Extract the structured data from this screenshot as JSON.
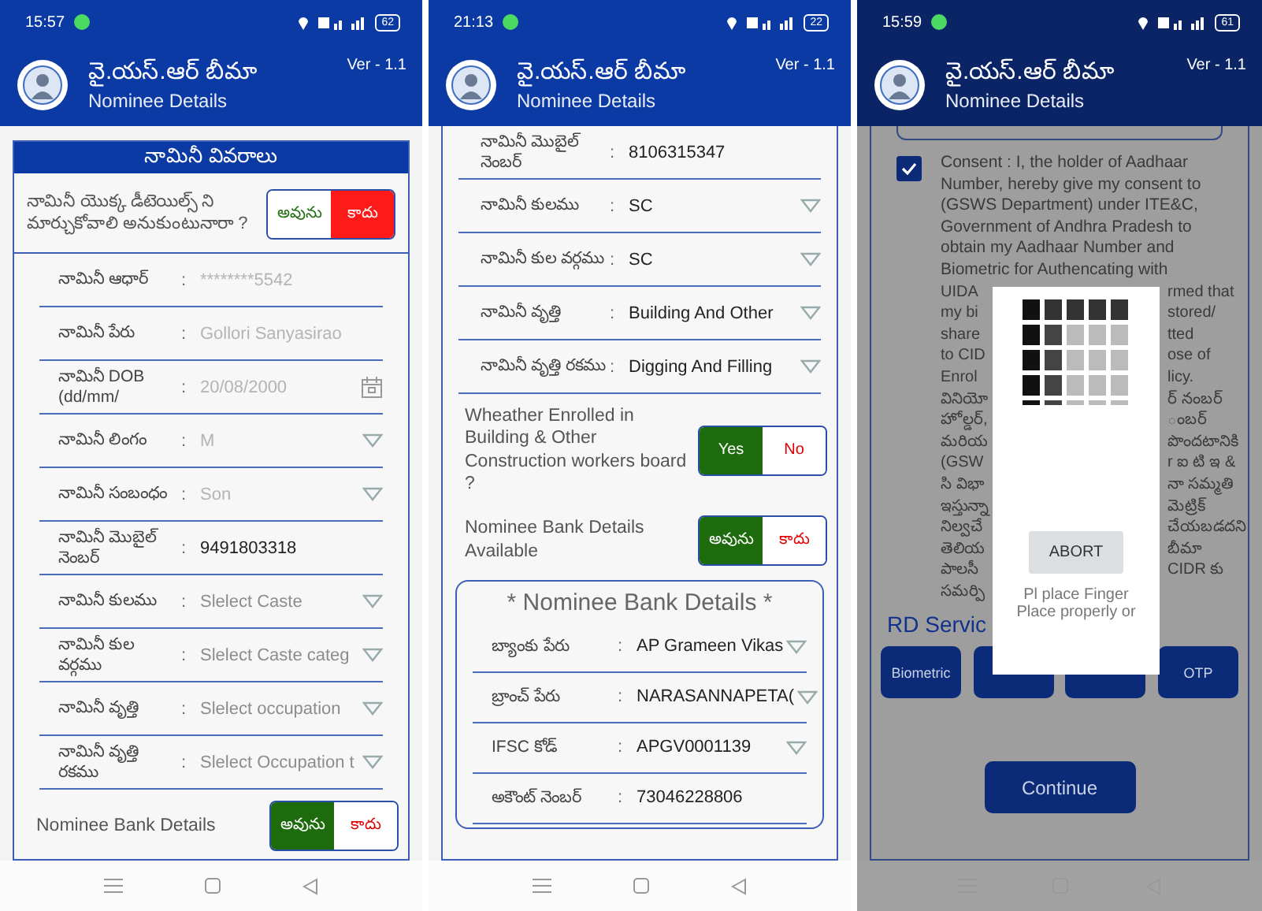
{
  "screens": [
    {
      "status": {
        "time": "15:57",
        "battery": "62"
      },
      "header": {
        "title": "వై.యస్.ఆర్ బీమా",
        "subtitle": "Nominee Details",
        "version": "Ver - 1.1"
      },
      "sections": [
        {
          "kind": "card_title",
          "text": "నామినీ వివరాలు"
        },
        {
          "kind": "toggle",
          "question": "నామినీ యొక్క డీటెయిల్స్ ని మార్చుకోవాలి అనుకుంటునారా ?",
          "options": [
            {
              "label": "అవును",
              "selected": false
            },
            {
              "label": "కాదు",
              "selected": true
            }
          ]
        },
        {
          "kind": "field",
          "label": "నామినీ ఆధార్",
          "colon": ":",
          "value": "********5542",
          "disabled": true
        },
        {
          "kind": "field",
          "label": "నామినీ పేరు",
          "colon": ":",
          "value": "Gollori Sanyasirao",
          "disabled": true
        },
        {
          "kind": "field",
          "label": "నామినీ DOB (dd/mm/",
          "colon": ":",
          "value": "20/08/2000",
          "disabled": true,
          "date_picker": true
        },
        {
          "kind": "field",
          "label": "నామినీ లింగం",
          "colon": ":",
          "value": "M",
          "disabled": true,
          "dropdown": true
        },
        {
          "kind": "field",
          "label": "నామినీ సంబంధం",
          "colon": ":",
          "value": "Son",
          "disabled": true,
          "dropdown": true
        },
        {
          "kind": "field",
          "label": "నామినీ మొబైల్ నెంబర్",
          "colon": ":",
          "value": "9491803318",
          "disabled": false
        },
        {
          "kind": "field",
          "label": "నామినీ కులము",
          "colon": ":",
          "placeholder": "Slelect Caste",
          "disabled": false,
          "dropdown": true
        },
        {
          "kind": "field",
          "label": "నామినీ కుల వర్గము",
          "colon": ":",
          "placeholder": "Slelect Caste categ",
          "disabled": false,
          "dropdown": true
        },
        {
          "kind": "field",
          "label": "నామినీ వృత్తి",
          "colon": ":",
          "placeholder": "Slelect occupation",
          "disabled": false,
          "dropdown": true
        },
        {
          "kind": "field",
          "label": "నామినీ వృత్తి రకము",
          "colon": ":",
          "placeholder": "Slelect Occupation t",
          "disabled": false,
          "dropdown": true
        },
        {
          "kind": "toggle",
          "question": "Nominee Bank Details",
          "options": [
            {
              "label": "అవును",
              "selected": true
            },
            {
              "label": "కాదు",
              "selected": false
            }
          ]
        }
      ]
    },
    {
      "status": {
        "time": "21:13",
        "battery": "22"
      },
      "header": {
        "title": "వై.యస్.ఆర్ బీమా",
        "subtitle": "Nominee Details",
        "version": "Ver - 1.1"
      },
      "sections": [
        {
          "kind": "field",
          "label": "నామినీ మొబైల్ నెంబర్",
          "colon": ":",
          "value": "8106315347",
          "disabled": false
        },
        {
          "kind": "field",
          "label": "నామినీ కులము",
          "colon": ":",
          "value": "SC",
          "disabled": false,
          "dropdown": true
        },
        {
          "kind": "field",
          "label": "నామినీ కుల వర్గము",
          "colon": ":",
          "value": "SC",
          "disabled": false,
          "dropdown": true
        },
        {
          "kind": "field",
          "label": "నామినీ వృత్తి",
          "colon": ":",
          "value": "Building And Other",
          "disabled": false,
          "dropdown": true
        },
        {
          "kind": "field",
          "label": "నామినీ వృత్తి రకము",
          "colon": ":",
          "value": "Digging And Filling",
          "disabled": false,
          "dropdown": true
        },
        {
          "kind": "toggle",
          "question": "Wheather Enrolled in Building & Other Construction workers board ?",
          "options": [
            {
              "label": "Yes",
              "selected": true
            },
            {
              "label": "No",
              "selected": false
            }
          ]
        },
        {
          "kind": "toggle",
          "question": "Nominee Bank Details Available",
          "options": [
            {
              "label": "అవును",
              "selected": true
            },
            {
              "label": "కాదు",
              "selected": false
            }
          ]
        },
        {
          "kind": "bank_card",
          "title": "* Nominee Bank Details *",
          "fields": [
            {
              "label": "బ్యాంకు పేరు",
              "colon": ":",
              "value": "AP Grameen Vikas",
              "disabled": false,
              "dropdown": true
            },
            {
              "label": "బ్రాంచ్ పేరు",
              "colon": ":",
              "value": "NARASANNAPETA(",
              "disabled": false,
              "dropdown": true
            },
            {
              "label": "IFSC కోడ్",
              "colon": ":",
              "value": "APGV0001139",
              "disabled": false,
              "dropdown": true
            },
            {
              "label": "అకౌంట్ నెంబర్",
              "colon": ":",
              "value": "73046228806",
              "disabled": false
            }
          ]
        }
      ]
    },
    {
      "status": {
        "time": "15:59",
        "battery": "61"
      },
      "header": {
        "title": "వై.యస్.ఆర్ బీమా",
        "subtitle": "Nominee Details",
        "version": "Ver - 1.1"
      },
      "sections": [
        {
          "kind": "card_bottom"
        },
        {
          "kind": "consent",
          "checked": true,
          "text": "Consent : I, the holder of Aadhaar Number, hereby give my consent to (GSWS Department) under ITE&C, Government of Andhra Pradesh to obtain my Aadhaar Number and Biometric for Authencating with",
          "fragments": [
            {
              "left": "UIDA",
              "right": "rmed that"
            },
            {
              "left": "my bi",
              "right": "stored/"
            },
            {
              "left": "share",
              "right": "tted"
            },
            {
              "left": "to CID",
              "right": "ose of"
            },
            {
              "left": "Enrol",
              "right": "licy."
            },
            {
              "left": "వినియో",
              "right": "ర్ నంబర్"
            },
            {
              "left": "హోల్డర్,",
              "right": "ంబర్"
            },
            {
              "left": "మరియ",
              "right": "పొందటానికి"
            },
            {
              "left": "(GSW",
              "right": "r ఐ టి ఇ &"
            },
            {
              "left": "సి విభా",
              "right": "నా సమ్మతి"
            },
            {
              "left": "ఇస్తున్నా",
              "right": "మెట్రిక్"
            },
            {
              "left": "నిల్వచే",
              "right": "చేయబడదని"
            },
            {
              "left": "తెలియ",
              "right": "బీమా"
            },
            {
              "left": "పాలసీ",
              "right": "CIDR కు"
            },
            {
              "left": "సమర్పి"
            }
          ]
        },
        {
          "kind": "rd_services",
          "heading": "RD Servic",
          "buttons": [
            "Biometric",
            "OTP"
          ]
        },
        {
          "kind": "button",
          "label": "Continue"
        }
      ],
      "dialog": {
        "button": "ABORT",
        "message": [
          "Pl place Finger",
          "Place properly or"
        ]
      }
    }
  ]
}
